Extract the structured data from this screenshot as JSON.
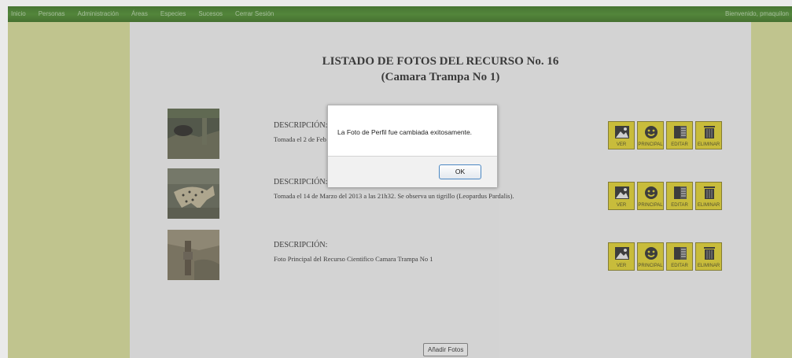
{
  "nav": {
    "items": [
      "Inicio",
      "Personas",
      "Administración",
      "Áreas",
      "Especies",
      "Sucesos",
      "Cerrar Sesión"
    ],
    "welcome": "Bienvenido, pmaquilon"
  },
  "page": {
    "title_line1": "LISTADO DE FOTOS DEL RECURSO No. 16",
    "title_line2": "(Camara Trampa No 1)"
  },
  "photos": [
    {
      "label": "DESCRIPCIÓN:",
      "text": "Tomada el 2 de Feb"
    },
    {
      "label": "DESCRIPCIÓN:",
      "text": "Tomada el 14 de Marzo del 2013 a las 21h32. Se observa un tigrillo (Leopardus Pardalis)."
    },
    {
      "label": "DESCRIPCIÓN:",
      "text": "Foto Principal del Recurso Cientifico Camara Trampa No 1"
    }
  ],
  "actions": {
    "view": "VER",
    "main": "PRINCIPAL",
    "edit": "EDITAR",
    "delete": "ELIMINAR"
  },
  "add_button": "Añadir Fotos",
  "dialog": {
    "message": "La Foto de Perfil fue cambiada exitosamente.",
    "ok": "OK"
  },
  "colors": {
    "nav_bg": "#3e7f1f",
    "side_bg": "#c9cf8a",
    "content_bg": "#e2e2e2",
    "action_bg": "#d4c51f"
  }
}
